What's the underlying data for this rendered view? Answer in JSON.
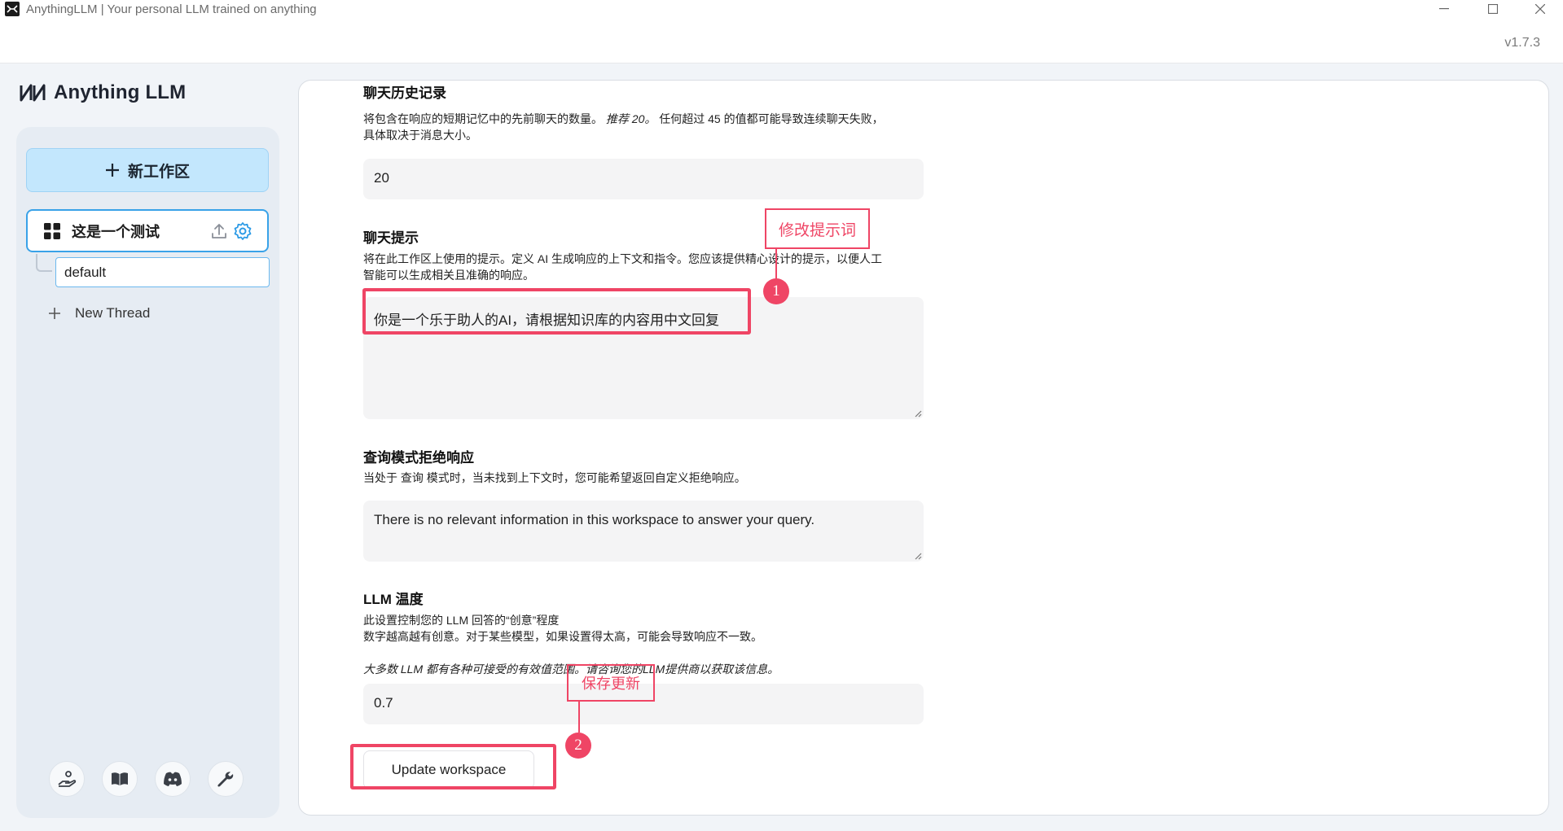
{
  "window": {
    "title": "AnythingLLM | Your personal LLM trained on anything",
    "version": "v1.7.3"
  },
  "sidebar": {
    "brand": "Anything LLM",
    "new_workspace": "新工作区",
    "workspace_name": "这是一个测试",
    "thread_name": "default",
    "new_thread": "New Thread",
    "footer_icons": [
      "support-icon",
      "docs-icon",
      "discord-icon",
      "settings-wrench-icon"
    ]
  },
  "settings": {
    "history": {
      "title": "聊天历史记录",
      "desc_1": "将包含在响应的短期记忆中的先前聊天的数量。",
      "desc_recommend": "推荐 20。",
      "desc_2": " 任何超过 45 的值都可能导致连续聊天失败，",
      "desc_3": "具体取决于消息大小。",
      "value": "20"
    },
    "prompt": {
      "title": "聊天提示",
      "desc_1": "将在此工作区上使用的提示。定义 AI 生成响应的上下文和指令。您应该提供精心设计的提示，以便人工",
      "desc_2": "智能可以生成相关且准确的响应。",
      "value": "你是一个乐于助人的AI，请根据知识库的内容用中文回复"
    },
    "refusal": {
      "title": "查询模式拒绝响应",
      "desc": "当处于 查询 模式时，当未找到上下文时，您可能希望返回自定义拒绝响应。",
      "value": "There is no relevant information in this workspace to answer your query."
    },
    "temperature": {
      "title": "LLM 温度",
      "desc_1": "此设置控制您的 LLM 回答的“创意”程度",
      "desc_2": "数字越高越有创意。对于某些模型，如果设置得太高，可能会导致响应不一致。",
      "desc_3": "大多数 LLM 都有各种可接受的有效值范围。请咨询您的LLM提供商以获取该信息。",
      "value": "0.7"
    },
    "update_button": "Update workspace"
  },
  "annotations": {
    "label_1": "修改提示词",
    "num_1": "1",
    "label_2": "保存更新",
    "num_2": "2",
    "color": "#ef4565"
  }
}
